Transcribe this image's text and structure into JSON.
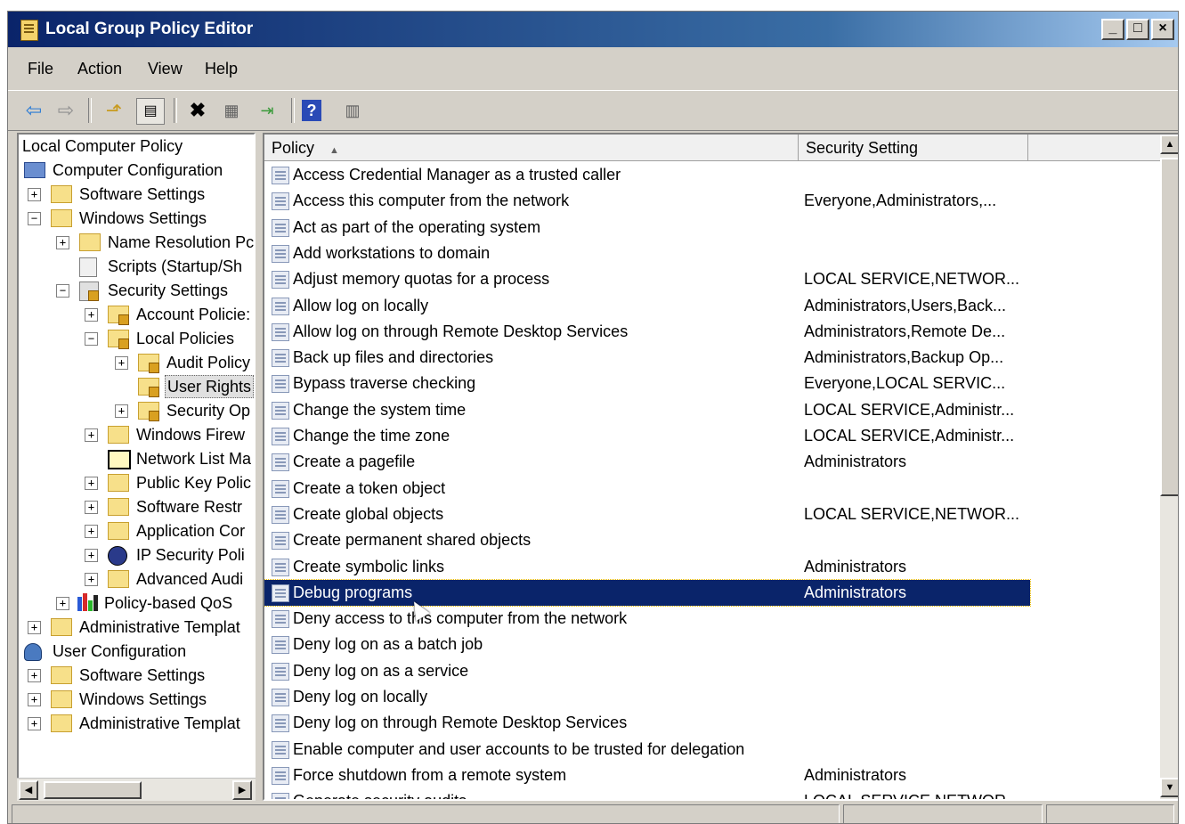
{
  "window": {
    "title": "Local Group Policy Editor",
    "caption_buttons": [
      "minimize",
      "maximize",
      "close"
    ]
  },
  "menu": {
    "items": [
      "File",
      "Action",
      "View",
      "Help"
    ]
  },
  "toolbar": {
    "icons": [
      "back-icon",
      "forward-icon",
      "up-folder-icon",
      "show-hide-tree-icon",
      "delete-icon",
      "properties-icon",
      "export-list-icon",
      "help-icon",
      "show-hide-action-pane-icon"
    ]
  },
  "tree": {
    "root": "Local Computer Policy",
    "items": [
      {
        "label": "Computer Configuration"
      },
      {
        "label": "Software Settings"
      },
      {
        "label": "Windows Settings"
      },
      {
        "label": "Name Resolution Pc"
      },
      {
        "label": "Scripts (Startup/Sh"
      },
      {
        "label": "Security Settings"
      },
      {
        "label": "Account Policie:"
      },
      {
        "label": "Local Policies"
      },
      {
        "label": "Audit Policy"
      },
      {
        "label": "User Rights"
      },
      {
        "label": "Security Op"
      },
      {
        "label": "Windows Firew"
      },
      {
        "label": "Network List Ma"
      },
      {
        "label": "Public Key Polic"
      },
      {
        "label": "Software Restr"
      },
      {
        "label": "Application Cor"
      },
      {
        "label": "IP Security Poli"
      },
      {
        "label": "Advanced Audi"
      },
      {
        "label": "Policy-based QoS"
      },
      {
        "label": "Administrative Templat"
      },
      {
        "label": "User Configuration"
      },
      {
        "label": "Software Settings"
      },
      {
        "label": "Windows Settings"
      },
      {
        "label": "Administrative Templat"
      }
    ]
  },
  "list": {
    "columns": [
      "Policy",
      "Security Setting"
    ],
    "sort_indicator": "▲",
    "rows": [
      {
        "policy": "Access Credential Manager as a trusted caller",
        "setting": ""
      },
      {
        "policy": "Access this computer from the network",
        "setting": "Everyone,Administrators,..."
      },
      {
        "policy": "Act as part of the operating system",
        "setting": ""
      },
      {
        "policy": "Add workstations to domain",
        "setting": ""
      },
      {
        "policy": "Adjust memory quotas for a process",
        "setting": "LOCAL SERVICE,NETWOR..."
      },
      {
        "policy": "Allow log on locally",
        "setting": "Administrators,Users,Back..."
      },
      {
        "policy": "Allow log on through Remote Desktop Services",
        "setting": "Administrators,Remote De..."
      },
      {
        "policy": "Back up files and directories",
        "setting": "Administrators,Backup Op..."
      },
      {
        "policy": "Bypass traverse checking",
        "setting": "Everyone,LOCAL SERVIC..."
      },
      {
        "policy": "Change the system time",
        "setting": "LOCAL SERVICE,Administr..."
      },
      {
        "policy": "Change the time zone",
        "setting": "LOCAL SERVICE,Administr..."
      },
      {
        "policy": "Create a pagefile",
        "setting": "Administrators"
      },
      {
        "policy": "Create a token object",
        "setting": ""
      },
      {
        "policy": "Create global objects",
        "setting": "LOCAL SERVICE,NETWOR..."
      },
      {
        "policy": "Create permanent shared objects",
        "setting": ""
      },
      {
        "policy": "Create symbolic links",
        "setting": "Administrators"
      },
      {
        "policy": "Debug programs",
        "setting": "Administrators",
        "selected": true
      },
      {
        "policy": "Deny access to this computer from the network",
        "setting": ""
      },
      {
        "policy": "Deny log on as a batch job",
        "setting": ""
      },
      {
        "policy": "Deny log on as a service",
        "setting": ""
      },
      {
        "policy": "Deny log on locally",
        "setting": ""
      },
      {
        "policy": "Deny log on through Remote Desktop Services",
        "setting": ""
      },
      {
        "policy": "Enable computer and user accounts to be trusted for delegation",
        "setting": ""
      },
      {
        "policy": "Force shutdown from a remote system",
        "setting": "Administrators"
      },
      {
        "policy": "Generate security audits",
        "setting": "LOCAL SERVICE,NETWOR..."
      }
    ]
  }
}
